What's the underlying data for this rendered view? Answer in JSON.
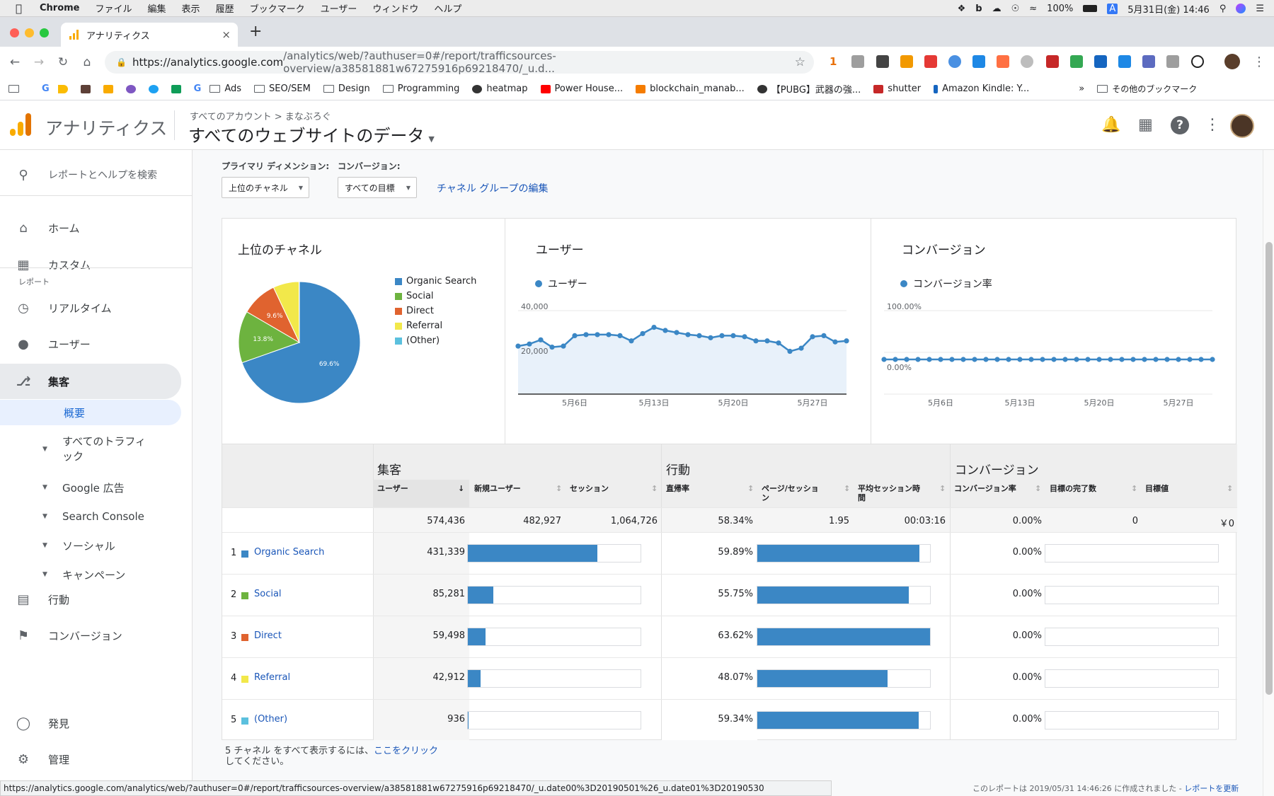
{
  "menubar": {
    "app": "Chrome",
    "items": [
      "ファイル",
      "編集",
      "表示",
      "履歴",
      "ブックマーク",
      "ユーザー",
      "ウィンドウ",
      "ヘルプ"
    ],
    "battery": "100%",
    "ime": "A",
    "datetime": "5月31日(金)  14:46"
  },
  "tab": {
    "title": "アナリティクス",
    "close": "×",
    "new": "+"
  },
  "url": {
    "host": "https://analytics.google.com",
    "path": "/analytics/web/?authuser=0#/report/trafficsources-overview/a38581881w67275916p69218470/_u.d..."
  },
  "toolbar_badge": "1",
  "bookmarks": [
    "Ads",
    "SEO/SEM",
    "Design",
    "Programming",
    "heatmap",
    "Power House...",
    "blockchain_manab...",
    "【PUBG】武器の強...",
    "shutter",
    "Amazon Kindle: Y...",
    "»",
    "その他のブックマーク"
  ],
  "ga": {
    "product": "アナリティクス",
    "crumb1": "すべてのアカウント",
    "crumb_sep": ">",
    "crumb2": "まなぶろぐ",
    "view": "すべてのウェブサイトのデータ"
  },
  "sidebar": {
    "search": "レポートとヘルプを検索",
    "home": "ホーム",
    "custom": "カスタム",
    "section": "レポート",
    "realtime": "リアルタイム",
    "users": "ユーザー",
    "acquisition": "集客",
    "overview": "概要",
    "all_traffic_1": "すべてのトラフィ",
    "all_traffic_2": "ック",
    "google_ads": "Google 広告",
    "search_console": "Search Console",
    "social": "ソーシャル",
    "campaigns": "キャンペーン",
    "behavior": "行動",
    "conversions": "コンバージョン",
    "discover": "発見",
    "admin": "管理"
  },
  "controls": {
    "primary_dim_label": "プライマリ ディメンション:",
    "primary_dim_value": "上位のチャネル",
    "conversion_label": "コンバージョン:",
    "conversion_value": "すべての目標",
    "edit_link": "チャネル グループの編集"
  },
  "panels": {
    "channels_title": "上位のチャネル",
    "users_title": "ユーザー",
    "users_series": "ユーザー",
    "conv_title": "コンバージョン",
    "conv_series": "コンバージョン率"
  },
  "colors": {
    "organic": "#3b87c5",
    "social": "#6db33f",
    "direct": "#e0632f",
    "referral": "#f2e84a",
    "other": "#5bc0de",
    "accent": "#3b87c5"
  },
  "chart_data": [
    {
      "type": "pie",
      "title": "上位のチャネル",
      "categories": [
        "Organic Search",
        "Social",
        "Direct",
        "Referral",
        "(Other)"
      ],
      "values": [
        69.6,
        13.8,
        9.6,
        6.9,
        0.1
      ],
      "labels": [
        "69.6%",
        "13.8%",
        "9.6%",
        "",
        ""
      ]
    },
    {
      "type": "line",
      "title": "ユーザー",
      "x": [
        "5月1日",
        "5月2日",
        "5月3日",
        "5月4日",
        "5月5日",
        "5月6日",
        "5月7日",
        "5月8日",
        "5月9日",
        "5月10日",
        "5月11日",
        "5月12日",
        "5月13日",
        "5月14日",
        "5月15日",
        "5月16日",
        "5月17日",
        "5月18日",
        "5月19日",
        "5月20日",
        "5月21日",
        "5月22日",
        "5月23日",
        "5月24日",
        "5月25日",
        "5月26日",
        "5月27日",
        "5月28日",
        "5月29日",
        "5月30日"
      ],
      "series": [
        {
          "name": "ユーザー",
          "values": [
            23000,
            24000,
            26000,
            22500,
            23000,
            28000,
            28500,
            28500,
            28500,
            28000,
            25500,
            29000,
            32000,
            30500,
            29500,
            28500,
            28000,
            27000,
            28000,
            28000,
            27500,
            25500,
            25500,
            24500,
            20500,
            22000,
            27500,
            28000,
            25000,
            25500
          ]
        }
      ],
      "x_ticks": [
        "5月6日",
        "5月13日",
        "5月20日",
        "5月27日"
      ],
      "y_ticks": [
        "40,000",
        "20,000"
      ],
      "ylim": [
        0,
        40000
      ]
    },
    {
      "type": "line",
      "title": "コンバージョン",
      "x_ticks": [
        "5月6日",
        "5月13日",
        "5月20日",
        "5月27日"
      ],
      "y_ticks": [
        "100.00%",
        "0.00%"
      ],
      "series": [
        {
          "name": "コンバージョン率",
          "values": [
            0,
            0,
            0,
            0,
            0,
            0,
            0,
            0,
            0,
            0,
            0,
            0,
            0,
            0,
            0,
            0,
            0,
            0,
            0,
            0,
            0,
            0,
            0,
            0,
            0,
            0,
            0,
            0,
            0,
            0
          ]
        }
      ],
      "ylim": [
        0,
        100
      ]
    }
  ],
  "table": {
    "group_acq": "集客",
    "group_beh": "行動",
    "group_conv": "コンバージョン",
    "h_users": "ユーザー",
    "h_new": "新規ユーザー",
    "h_sessions": "セッション",
    "h_bounce": "直帰率",
    "h_pages_1": "ページ/セッショ",
    "h_pages_2": "ン",
    "h_dur_1": "平均セッション時",
    "h_dur_2": "間",
    "h_cr": "コンバージョン率",
    "h_goals": "目標の完了数",
    "h_value": "目標値",
    "totals": {
      "users": "574,436",
      "new": "482,927",
      "sessions": "1,064,726",
      "bounce": "58.34%",
      "pages": "1.95",
      "dur": "00:03:16",
      "cr": "0.00%",
      "goals": "0",
      "value": "￥0"
    },
    "rows": [
      {
        "rank": "1",
        "name": "Organic Search",
        "users": "431,339",
        "users_frac": 0.75,
        "bounce": "59.89%",
        "bounce_frac": 0.94,
        "cr": "0.00%"
      },
      {
        "rank": "2",
        "name": "Social",
        "users": "85,281",
        "users_frac": 0.148,
        "bounce": "55.75%",
        "bounce_frac": 0.876,
        "cr": "0.00%"
      },
      {
        "rank": "3",
        "name": "Direct",
        "users": "59,498",
        "users_frac": 0.103,
        "bounce": "63.62%",
        "bounce_frac": 1.0,
        "cr": "0.00%"
      },
      {
        "rank": "4",
        "name": "Referral",
        "users": "42,912",
        "users_frac": 0.074,
        "bounce": "48.07%",
        "bounce_frac": 0.756,
        "cr": "0.00%"
      },
      {
        "rank": "5",
        "name": "(Other)",
        "users": "936",
        "users_frac": 0.002,
        "bounce": "59.34%",
        "bounce_frac": 0.933,
        "cr": "0.00%"
      }
    ]
  },
  "footnote": {
    "text1": "5 チャネル をすべて表示するには、",
    "link": "ここをクリック",
    "text2": "してください。"
  },
  "statusbar": "https://analytics.google.com/analytics/web/?authuser=0#/report/trafficsources-overview/a38581881w67275916p69218470/_u.date00%3D20190501%26_u.date01%3D20190530",
  "report_footer": {
    "text": "このレポートは 2019/05/31 14:46:26 に作成されました - ",
    "link": "レポートを更新"
  }
}
